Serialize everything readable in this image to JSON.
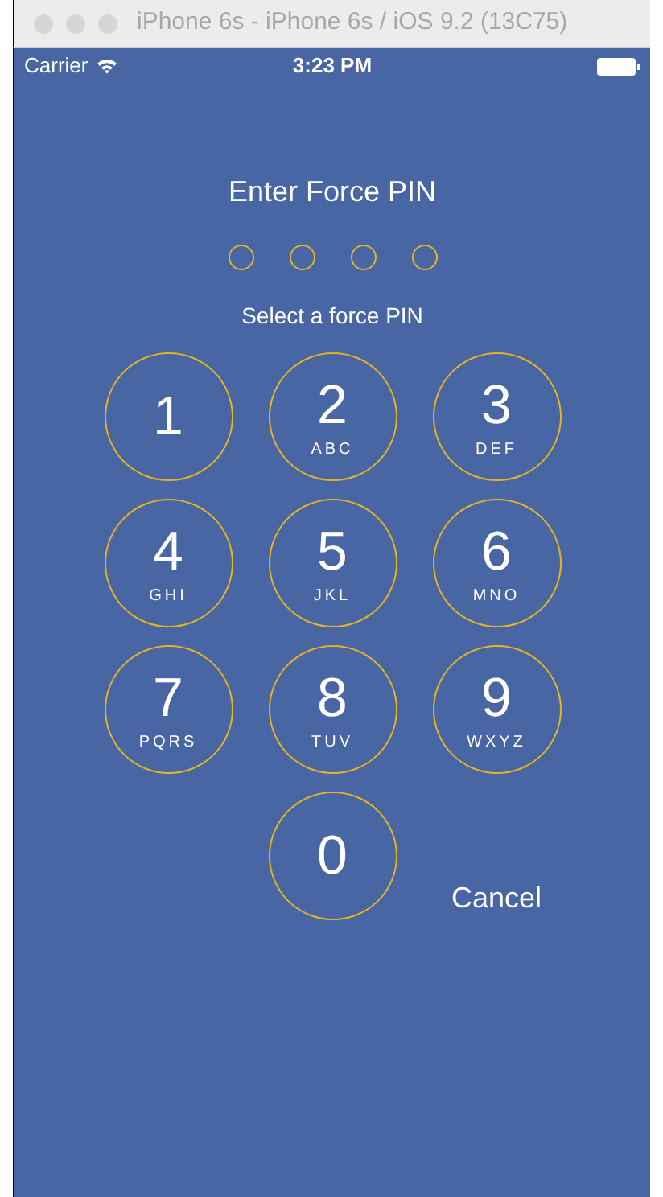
{
  "window": {
    "title": "iPhone 6s - iPhone 6s / iOS 9.2 (13C75)"
  },
  "status_bar": {
    "carrier": "Carrier",
    "time": "3:23 PM"
  },
  "title": "Enter Force PIN",
  "pin_dots": [
    {
      "filled": false
    },
    {
      "filled": false
    },
    {
      "filled": false
    },
    {
      "filled": false
    }
  ],
  "subtitle": "Select a force PIN",
  "keys": [
    {
      "digit": "1"
    },
    {
      "digit": "2",
      "letters": "ABC"
    },
    {
      "digit": "3",
      "letters": "DEF"
    },
    {
      "digit": "4",
      "letters": "GHI"
    },
    {
      "digit": "5",
      "letters": "JKL"
    },
    {
      "digit": "6",
      "letters": "MNO"
    },
    {
      "digit": "7",
      "letters": "PQRS"
    },
    {
      "digit": "8",
      "letters": "TUV"
    },
    {
      "digit": "9",
      "letters": "WXYZ"
    },
    {
      "digit": "0"
    }
  ],
  "cancel": "Cancel"
}
